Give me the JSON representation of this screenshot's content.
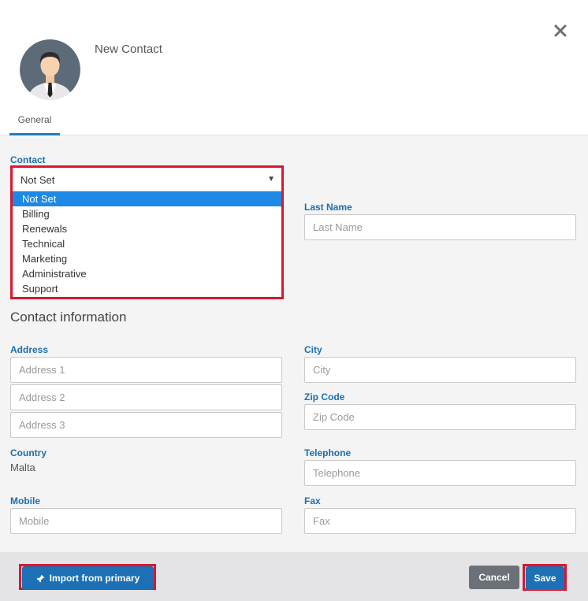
{
  "dialog": {
    "title": "New Contact"
  },
  "tabs": [
    {
      "label": "General"
    }
  ],
  "contact": {
    "label": "Contact",
    "selected": "Not Set",
    "options": [
      "Not Set",
      "Billing",
      "Renewals",
      "Technical",
      "Marketing",
      "Administrative",
      "Support"
    ]
  },
  "last_name": {
    "label": "Last Name",
    "placeholder": "Last Name"
  },
  "contact_information": {
    "title": "Contact information",
    "address": {
      "label": "Address",
      "line1_placeholder": "Address 1",
      "line2_placeholder": "Address 2",
      "line3_placeholder": "Address 3"
    },
    "city": {
      "label": "City",
      "placeholder": "City"
    },
    "zip": {
      "label": "Zip Code",
      "placeholder": "Zip Code"
    },
    "country": {
      "label": "Country",
      "value": "Malta"
    },
    "telephone": {
      "label": "Telephone",
      "placeholder": "Telephone"
    },
    "mobile": {
      "label": "Mobile",
      "placeholder": "Mobile"
    },
    "fax": {
      "label": "Fax",
      "placeholder": "Fax"
    }
  },
  "footer": {
    "import_label": "Import from primary",
    "cancel_label": "Cancel",
    "save_label": "Save"
  },
  "colors": {
    "accent": "#1c70b6",
    "label_blue": "#1a6fb0",
    "highlight_red": "#d9182d",
    "selected_option": "#1e88e5",
    "cancel_gray": "#6b7177"
  },
  "icons": {
    "avatar": "person-avatar",
    "close": "close-icon",
    "import": "pin-icon",
    "dropdown": "caret-down-icon"
  }
}
